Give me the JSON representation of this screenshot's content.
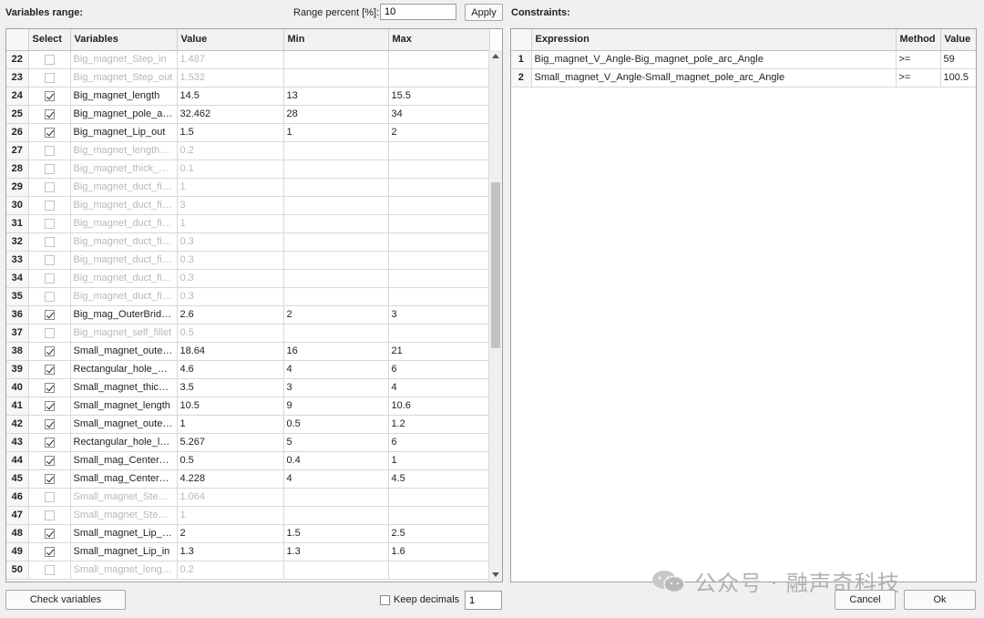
{
  "left_panel": {
    "title": "Variables range:",
    "range_percent_label": "Range percent [%]:",
    "range_percent_value": "10",
    "apply_label": "Apply",
    "columns": [
      "Select",
      "Variables",
      "Value",
      "Min",
      "Max"
    ],
    "rows": [
      {
        "n": "22",
        "checked": false,
        "var": "Big_magnet_Step_in",
        "value": "1.487",
        "min": "",
        "max": ""
      },
      {
        "n": "23",
        "checked": false,
        "var": "Big_magnet_Step_out",
        "value": "1.532",
        "min": "",
        "max": ""
      },
      {
        "n": "24",
        "checked": true,
        "var": "Big_magnet_length",
        "value": "14.5",
        "min": "13",
        "max": "15.5"
      },
      {
        "n": "25",
        "checked": true,
        "var": "Big_magnet_pole_a…",
        "value": "32.462",
        "min": "28",
        "max": "34"
      },
      {
        "n": "26",
        "checked": true,
        "var": "Big_magnet_Lip_out",
        "value": "1.5",
        "min": "1",
        "max": "2"
      },
      {
        "n": "27",
        "checked": false,
        "var": "Big_magnet_length…",
        "value": "0.2",
        "min": "",
        "max": ""
      },
      {
        "n": "28",
        "checked": false,
        "var": "Big_magnet_thick_g…",
        "value": "0.1",
        "min": "",
        "max": ""
      },
      {
        "n": "29",
        "checked": false,
        "var": "Big_magnet_duct_fil…",
        "value": "1",
        "min": "",
        "max": ""
      },
      {
        "n": "30",
        "checked": false,
        "var": "Big_magnet_duct_fil…",
        "value": "3",
        "min": "",
        "max": ""
      },
      {
        "n": "31",
        "checked": false,
        "var": "Big_magnet_duct_fil…",
        "value": "1",
        "min": "",
        "max": ""
      },
      {
        "n": "32",
        "checked": false,
        "var": "Big_magnet_duct_fil…",
        "value": "0.3",
        "min": "",
        "max": ""
      },
      {
        "n": "33",
        "checked": false,
        "var": "Big_magnet_duct_fil…",
        "value": "0.3",
        "min": "",
        "max": ""
      },
      {
        "n": "34",
        "checked": false,
        "var": "Big_magnet_duct_fil…",
        "value": "0.3",
        "min": "",
        "max": ""
      },
      {
        "n": "35",
        "checked": false,
        "var": "Big_magnet_duct_fil…",
        "value": "0.3",
        "min": "",
        "max": ""
      },
      {
        "n": "36",
        "checked": true,
        "var": "Big_mag_OuterBrid…",
        "value": "2.6",
        "min": "2",
        "max": "3"
      },
      {
        "n": "37",
        "checked": false,
        "var": "Big_magnet_self_fillet",
        "value": "0.5",
        "min": "",
        "max": ""
      },
      {
        "n": "38",
        "checked": true,
        "var": "Small_magnet_oute…",
        "value": "18.64",
        "min": "16",
        "max": "21"
      },
      {
        "n": "39",
        "checked": true,
        "var": "Rectangular_hole_…",
        "value": "4.6",
        "min": "4",
        "max": "6"
      },
      {
        "n": "40",
        "checked": true,
        "var": "Small_magnet_thick…",
        "value": "3.5",
        "min": "3",
        "max": "4"
      },
      {
        "n": "41",
        "checked": true,
        "var": "Small_magnet_length",
        "value": "10.5",
        "min": "9",
        "max": "10.6"
      },
      {
        "n": "42",
        "checked": true,
        "var": "Small_magnet_oute…",
        "value": "1",
        "min": "0.5",
        "max": "1.2"
      },
      {
        "n": "43",
        "checked": true,
        "var": "Rectangular_hole_l…",
        "value": "5.267",
        "min": "5",
        "max": "6"
      },
      {
        "n": "44",
        "checked": true,
        "var": "Small_mag_Center…",
        "value": "0.5",
        "min": "0.4",
        "max": "1"
      },
      {
        "n": "45",
        "checked": true,
        "var": "Small_mag_Center…",
        "value": "4.228",
        "min": "4",
        "max": "4.5"
      },
      {
        "n": "46",
        "checked": false,
        "var": "Small_magnet_Step…",
        "value": "1.064",
        "min": "",
        "max": ""
      },
      {
        "n": "47",
        "checked": false,
        "var": "Small_magnet_Step…",
        "value": "1",
        "min": "",
        "max": ""
      },
      {
        "n": "48",
        "checked": true,
        "var": "Small_magnet_Lip_…",
        "value": "2",
        "min": "1.5",
        "max": "2.5"
      },
      {
        "n": "49",
        "checked": true,
        "var": "Small_magnet_Lip_in",
        "value": "1.3",
        "min": "1.3",
        "max": "1.6"
      },
      {
        "n": "50",
        "checked": false,
        "var": "Small_magnet_leng…",
        "value": "0.2",
        "min": "",
        "max": ""
      }
    ],
    "check_variables_label": "Check variables",
    "keep_decimals_label": "Keep decimals",
    "keep_decimals_checked": false,
    "decimals_value": "1"
  },
  "right_panel": {
    "title": "Constraints:",
    "columns": [
      "Expression",
      "Method",
      "Value"
    ],
    "rows": [
      {
        "n": "1",
        "expr": "Big_magnet_V_Angle-Big_magnet_pole_arc_Angle",
        "method": ">=",
        "value": "59"
      },
      {
        "n": "2",
        "expr": "Small_magnet_V_Angle-Small_magnet_pole_arc_Angle",
        "method": ">=",
        "value": "100.5"
      }
    ],
    "cancel_label": "Cancel",
    "ok_label": "Ok"
  },
  "watermark": {
    "icon": "wechat-icon",
    "text": "公众号 · 融声奇科技"
  }
}
